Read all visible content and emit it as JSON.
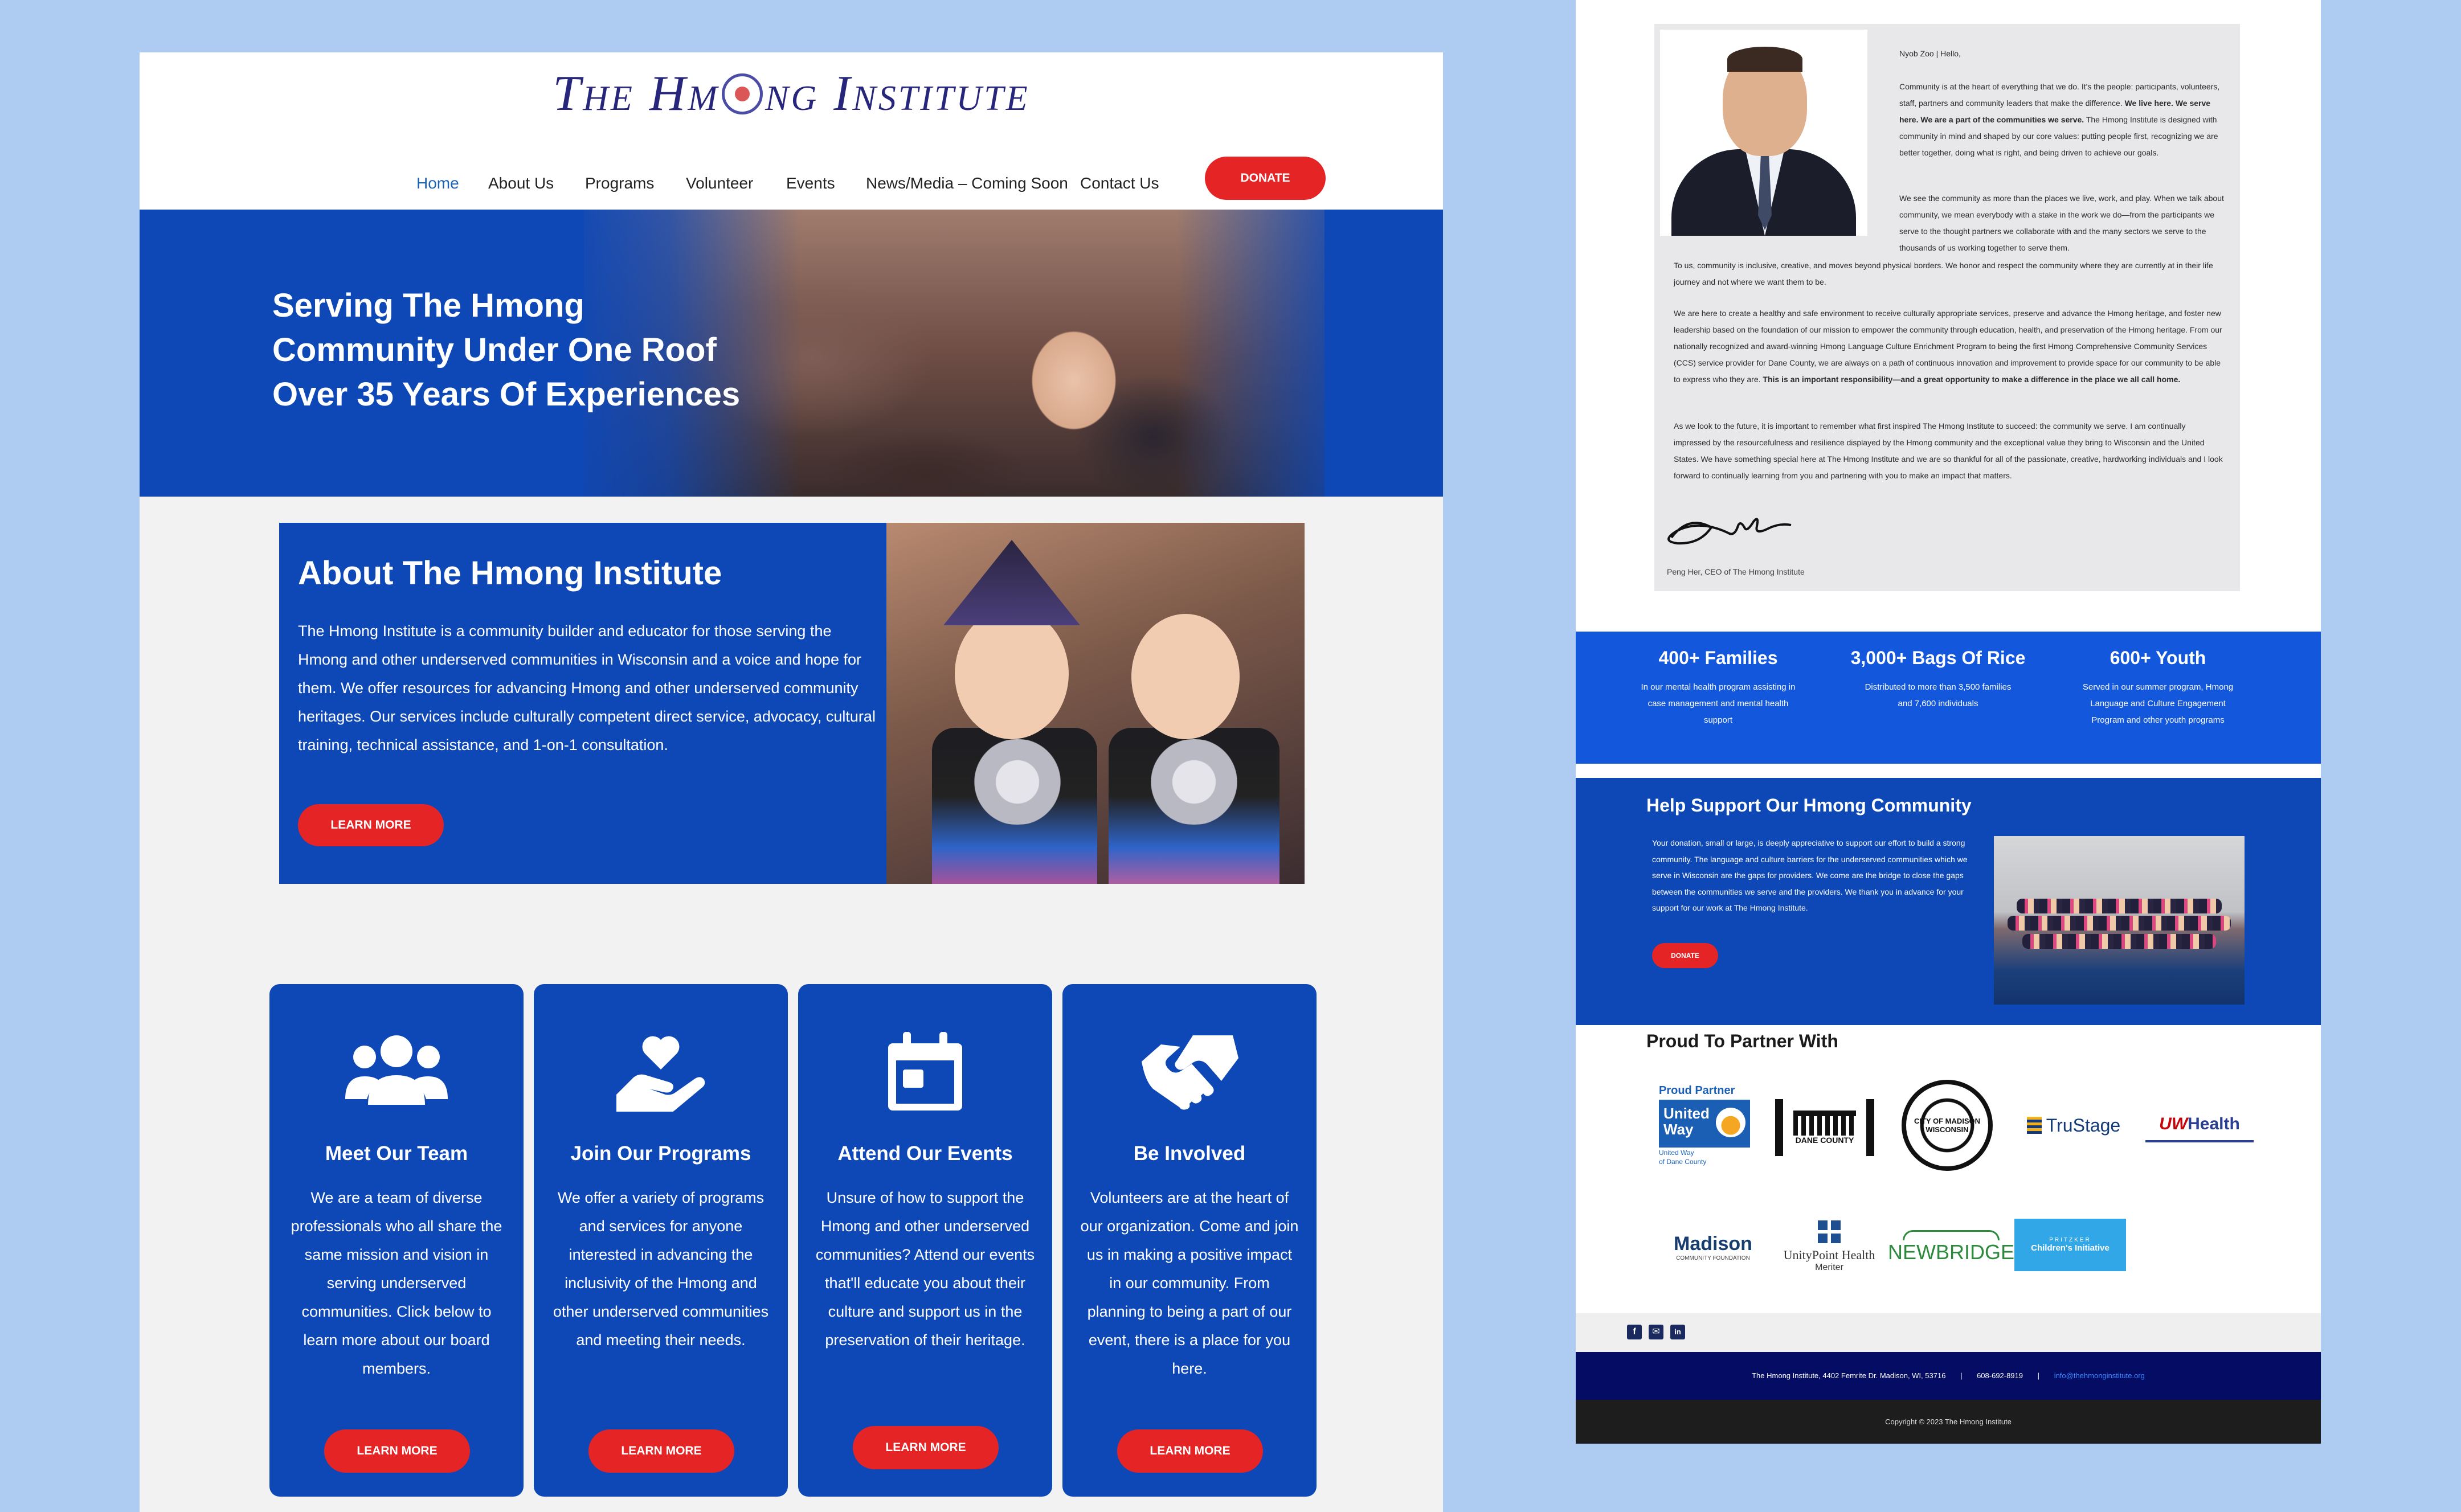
{
  "site": {
    "logo_text": "THE HM NG INSTITUTE",
    "logo_part1": "The Hm",
    "logo_part2": "ng Institute"
  },
  "nav": {
    "items": [
      "Home",
      "About Us",
      "Programs",
      "Volunteer",
      "Events",
      "News/Media – Coming Soon",
      "Contact Us"
    ],
    "active": "Home",
    "donate_label": "DONATE"
  },
  "hero": {
    "line1": "Serving The Hmong",
    "line2": "Community Under One Roof",
    "line3": "Over 35 Years Of Experiences"
  },
  "about": {
    "title": "About The Hmong Institute",
    "text": "The Hmong Institute is a community builder and educator for those serving the Hmong and other underserved communities in Wisconsin and a voice and hope for them. We offer resources for advancing Hmong and other underserved community heritages. Our services include culturally competent direct service, advocacy, cultural training, technical assistance, and 1-on-1 consultation.",
    "button": "LEARN MORE"
  },
  "cards": [
    {
      "icon": "users-group-icon",
      "title": "Meet Our Team",
      "text": "We are a team of diverse professionals who all share the same mission and vision in serving underserved communities. Click below to learn more about our board members.",
      "button": "LEARN MORE"
    },
    {
      "icon": "hand-heart-icon",
      "title": "Join Our Programs",
      "text": "We offer a variety of programs and services for anyone interested in advancing the inclusivity of the Hmong  and other underserved communities  and meeting their needs.",
      "button": "LEARN MORE"
    },
    {
      "icon": "calendar-icon",
      "title": "Attend Our Events",
      "text": "Unsure of how to support the Hmong and other underserved communities? Attend our events that'll educate you about their culture and support us in the preservation of their heritage.",
      "button": "LEARN MORE"
    },
    {
      "icon": "handshake-icon",
      "title": "Be Involved",
      "text": "Volunteers are at the heart of our organization. Come and join us in making a positive impact in our community. From planning to being a part of our event, there is a place for you here.",
      "button": "LEARN MORE"
    }
  ],
  "letter": {
    "greeting": "Nyob Zoo | Hello,",
    "p1": "Community is at the heart of everything that we do. It's the people: participants, volunteers, staff, partners and community leaders that make the difference.",
    "p1_bold": "We live here. We serve here. We are a part of the communities we serve.",
    "p1_end": "The Hmong Institute is designed with community in mind and shaped by our core values: putting people first, recognizing we are better together, doing what is right, and being driven to achieve our goals.",
    "p2": "We see the community as more than the places we live, work, and play. When we talk about community, we mean everybody with a stake in the work we do—from the participants we serve to the thought partners we collaborate with and the many sectors we serve to the thousands of us working together to serve them.",
    "p3": "To us, community is inclusive, creative, and moves beyond physical borders. We honor and respect the community where they are currently at in their life journey and not where we want them to be.",
    "p4": "We are here to create a healthy and safe environment to receive culturally appropriate services, preserve and advance the Hmong heritage, and foster new leadership based on the foundation of our mission to empower the community through education, health, and preservation of the Hmong heritage. From our nationally recognized and award-winning Hmong Language Culture Enrichment Program to being the first Hmong Comprehensive Community Services (CCS) service provider for Dane County, we are always on a path of continuous innovation and improvement to provide space for our community to be able to express who they are.",
    "p4_bold": "This is an important responsibility—and a great opportunity to make a difference in the place we all call home.",
    "p5": "As we look to the future, it is important to remember what first inspired The Hmong Institute to succeed: the community we serve. I am continually impressed by the resourcefulness and resilience displayed by the Hmong community and the exceptional value they bring to Wisconsin and the United States. We have something special here at The Hmong Institute and we are so thankful for all of the passionate, creative, hardworking individuals and I look forward to continually learning from you and partnering with you to make an impact that matters.",
    "signature_caption": "Peng Her, CEO of The Hmong Institute"
  },
  "stats": [
    {
      "number": "400+ Families",
      "caption": "In our mental health program assisting in case management and mental health support"
    },
    {
      "number": "3,000+ Bags Of Rice",
      "caption": "Distributed to more than 3,500 families and 7,600 individuals"
    },
    {
      "number": "600+ Youth",
      "caption": "Served in our summer program, Hmong Language and Culture Engagement Program and other youth programs"
    }
  ],
  "support": {
    "title": "Help Support Our Hmong Community",
    "text": "Your donation, small or large, is deeply appreciative to support our effort to build a strong community. The language and culture barriers for the underserved communities which we serve in Wisconsin are the gaps for providers. We come are the bridge to close the gaps between the communities we serve and the providers. We thank you in advance for your support for our work at The Hmong Institute.",
    "button": "DONATE"
  },
  "partners": {
    "title": "Proud To Partner With",
    "united_way": {
      "top": "Proud Partner",
      "line1": "United",
      "line2": "Way",
      "sub1": "United Way",
      "sub2": "of Dane County"
    },
    "dane": "DANE COUNTY",
    "madison_city_top": "CITY OF MADISON",
    "madison_city_bottom": "WISCONSIN",
    "trustage": "TruStage",
    "uwhealth_uw": "UW",
    "uwhealth_health": "Health",
    "madison_cf": "Madison",
    "madison_cf_sub": "COMMUNITY FOUNDATION",
    "unitypoint": "UnityPoint Health",
    "unitypoint_sub": "Meriter",
    "newbridge": "NEWBRIDGE",
    "pritzker_top": "PRITZKER",
    "pritzker_main": "Children's Initiative"
  },
  "footer": {
    "address": "The Hmong Institute, 4402 Femrite Dr. Madison, WI, 53716",
    "phone": "608-692-8919",
    "email": "info@thehmonginstitute.org",
    "copyright": "Copyright © 2023 The Hmong Institute"
  },
  "colors": {
    "brand_blue": "#0e48b7",
    "bright_blue": "#1357dd",
    "donate_red": "#e52426",
    "logo_navy": "#27267a",
    "footer_navy": "#040d63"
  }
}
